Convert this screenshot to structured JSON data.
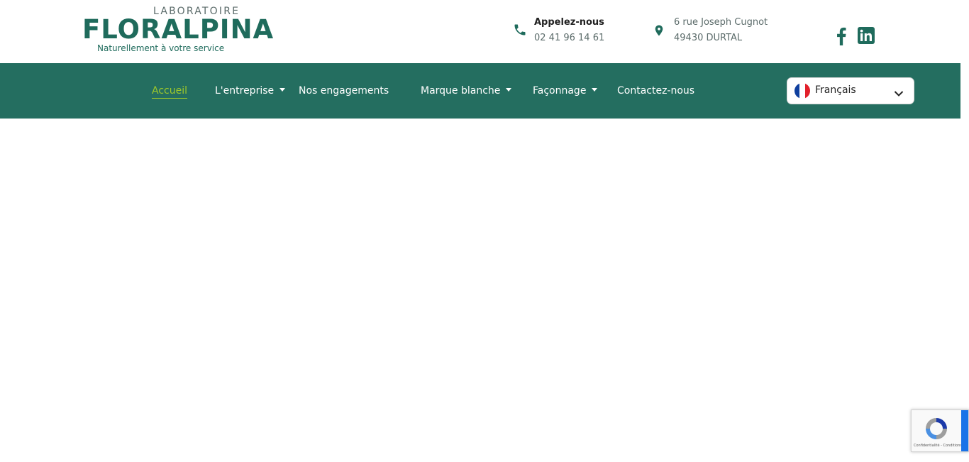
{
  "header": {
    "logo": {
      "kicker": "LABORATOIRE",
      "brand": "FLORALPINA",
      "tagline": "Naturellement à votre service"
    },
    "phone": {
      "icon": "phone-icon",
      "label": "Appelez-nous",
      "number": "02 41 96 14 61"
    },
    "address": {
      "icon": "map-pin-icon",
      "street": "6 rue Joseph Cugnot",
      "city": "49430 DURTAL"
    },
    "social": [
      {
        "icon": "facebook-icon"
      },
      {
        "icon": "linkedin-icon"
      }
    ]
  },
  "nav": {
    "items": [
      {
        "label": "Accueil",
        "active": true
      },
      {
        "label": "L'entreprise",
        "dropdown": true
      },
      {
        "label": "Nos engagements"
      },
      {
        "label": "Marque blanche",
        "dropdown": true
      },
      {
        "label": "Façonnage",
        "dropdown": true
      },
      {
        "label": "Contactez-nous"
      }
    ]
  },
  "language": {
    "selected": "Français",
    "flag_icon": "france-flag-icon"
  },
  "recaptcha": {
    "links": "Confidentialité - Conditions"
  },
  "colors": {
    "brand_green": "#246e60",
    "accent_lime": "#9fc92a",
    "text_grey": "#5b6b6a",
    "white": "#ffffff"
  }
}
